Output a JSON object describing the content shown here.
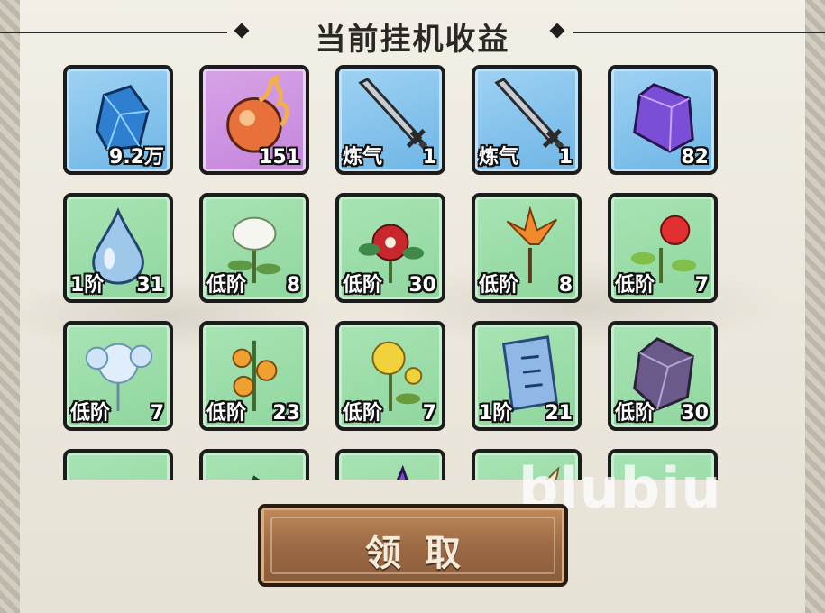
{
  "header": {
    "title": "当前挂机收益"
  },
  "rewards": [
    {
      "icon": "blue-gem-icon",
      "frame": "blue",
      "tier": "",
      "count": "9.2万"
    },
    {
      "icon": "fire-orb-icon",
      "frame": "purple",
      "tier": "",
      "count": "151"
    },
    {
      "icon": "sword-icon",
      "frame": "blue",
      "tier": "炼气",
      "count": "1"
    },
    {
      "icon": "sword-icon",
      "frame": "blue",
      "tier": "炼气",
      "count": "1"
    },
    {
      "icon": "purple-crystal-icon",
      "frame": "blue",
      "tier": "",
      "count": "82"
    },
    {
      "icon": "water-drop-icon",
      "frame": "green",
      "tier": "1阶",
      "count": "31"
    },
    {
      "icon": "white-lotus-herb-icon",
      "frame": "green",
      "tier": "低阶",
      "count": "8"
    },
    {
      "icon": "red-flower-herb-icon",
      "frame": "green",
      "tier": "低阶",
      "count": "30"
    },
    {
      "icon": "orange-flower-herb-icon",
      "frame": "green",
      "tier": "低阶",
      "count": "8"
    },
    {
      "icon": "red-hibiscus-herb-icon",
      "frame": "green",
      "tier": "低阶",
      "count": "7"
    },
    {
      "icon": "ice-flower-herb-icon",
      "frame": "green",
      "tier": "低阶",
      "count": "7"
    },
    {
      "icon": "orange-berry-herb-icon",
      "frame": "green",
      "tier": "低阶",
      "count": "23"
    },
    {
      "icon": "yellow-flower-herb-icon",
      "frame": "green",
      "tier": "低阶",
      "count": "7"
    },
    {
      "icon": "talisman-scroll-icon",
      "frame": "green",
      "tier": "1阶",
      "count": "21"
    },
    {
      "icon": "dark-crystal-icon",
      "frame": "green",
      "tier": "低阶",
      "count": "30"
    },
    {
      "icon": "teal-ore-icon",
      "frame": "green",
      "tier": "",
      "count": ""
    },
    {
      "icon": "green-crystal-icon",
      "frame": "green",
      "tier": "",
      "count": ""
    },
    {
      "icon": "violet-shard-icon",
      "frame": "green",
      "tier": "",
      "count": ""
    },
    {
      "icon": "feather-icon",
      "frame": "green",
      "tier": "",
      "count": ""
    },
    {
      "icon": "copper-ore-icon",
      "frame": "green",
      "tier": "",
      "count": ""
    }
  ],
  "watermark": "blubiu",
  "claim_button": {
    "label": "领取"
  },
  "colors": {
    "blue_frame": "#7fc0ec",
    "purple_frame": "#cc8fe0",
    "green_frame": "#9adca8",
    "button_brown": "#9c6b45"
  }
}
